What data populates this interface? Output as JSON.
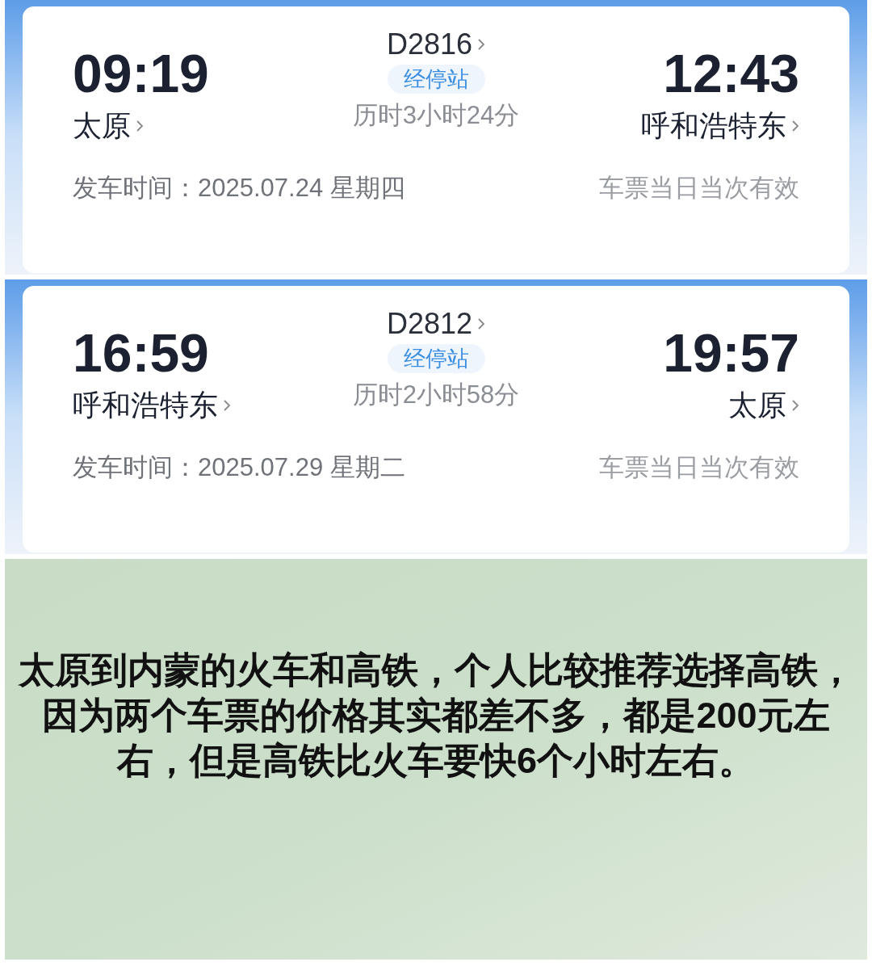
{
  "tickets": [
    {
      "depart_time": "09:19",
      "train_no": "D2816",
      "stops_label": "经停站",
      "arrive_time": "12:43",
      "from_station": "太原",
      "duration": "历时3小时24分",
      "to_station": "呼和浩特东",
      "date_label": "发车时间：",
      "date": "2025.07.24 星期四",
      "validity": "车票当日当次有效"
    },
    {
      "depart_time": "16:59",
      "train_no": "D2812",
      "stops_label": "经停站",
      "arrive_time": "19:57",
      "from_station": "呼和浩特东",
      "duration": "历时2小时58分",
      "to_station": "太原",
      "date_label": "发车时间：",
      "date": "2025.07.29 星期二",
      "validity": "车票当日当次有效"
    }
  ],
  "caption": "太原到内蒙的火车和高铁，个人比较推荐选择高铁，因为两个车票的价格其实都差不多，都是200元左右，但是高铁比火车要快6个小时左右。"
}
